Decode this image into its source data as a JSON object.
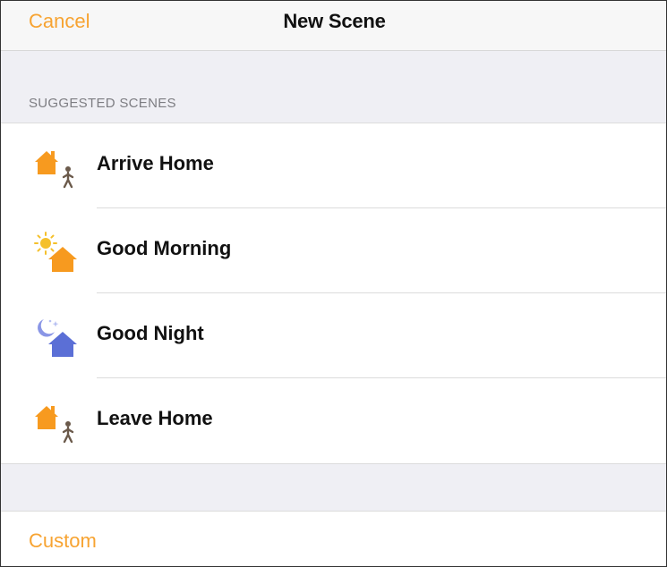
{
  "navbar": {
    "cancel_label": "Cancel",
    "title": "New Scene"
  },
  "suggested": {
    "header": "SUGGESTED SCENES",
    "items": [
      {
        "label": "Arrive Home",
        "icon": "arrive-home-icon"
      },
      {
        "label": "Good Morning",
        "icon": "good-morning-icon"
      },
      {
        "label": "Good Night",
        "icon": "good-night-icon"
      },
      {
        "label": "Leave Home",
        "icon": "leave-home-icon"
      }
    ]
  },
  "custom": {
    "label": "Custom"
  },
  "colors": {
    "accent": "#f7a331",
    "house_orange": "#f79a1f",
    "house_night": "#5b6fd6",
    "person": "#6b5a4b"
  }
}
